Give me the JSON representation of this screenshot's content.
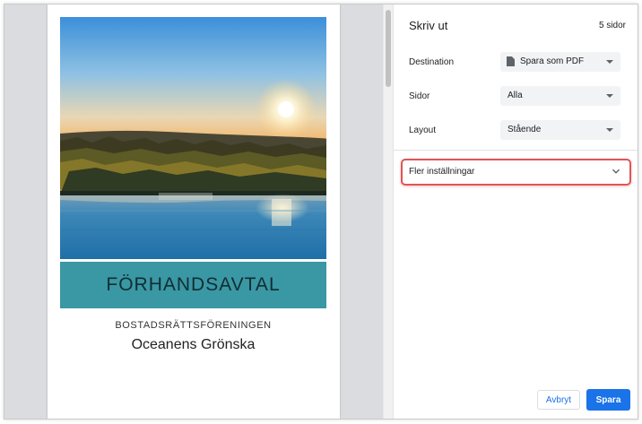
{
  "preview": {
    "cover_title": "FÖRHANDSAVTAL",
    "cover_subtitle": "BOSTADSRÄTTSFÖRENINGEN",
    "association_name": "Oceanens Grönska",
    "banner_color": "#3a97a4"
  },
  "panel": {
    "title": "Skriv ut",
    "page_count": "5 sidor",
    "destination": {
      "label": "Destination",
      "value": "Spara som PDF",
      "icon": "document-icon"
    },
    "pages": {
      "label": "Sidor",
      "value": "Alla"
    },
    "layout": {
      "label": "Layout",
      "value": "Stående"
    },
    "more_settings": {
      "label": "Fler inställningar",
      "icon": "chevron-down-icon"
    },
    "cancel_label": "Avbryt",
    "save_label": "Spara"
  },
  "colors": {
    "accent": "#1a73e8",
    "highlight": "#e05555"
  }
}
